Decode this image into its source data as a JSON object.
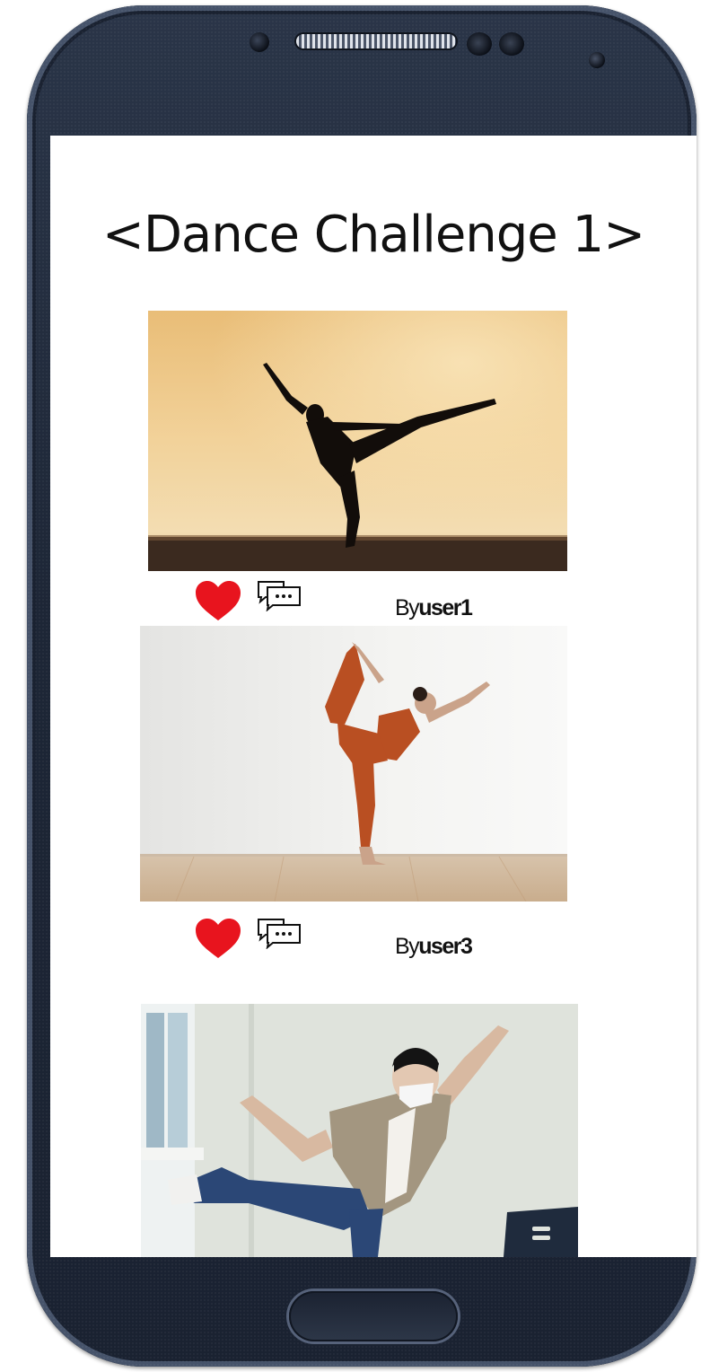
{
  "screen": {
    "title": "<Dance Challenge 1>"
  },
  "posts": [
    {
      "by_prefix": "By",
      "user": "user1",
      "like_icon": "heart-icon",
      "comment_icon": "comment-icon"
    },
    {
      "by_prefix": "By",
      "user": "user3",
      "like_icon": "heart-icon",
      "comment_icon": "comment-icon"
    },
    {
      "by_prefix": "",
      "user": ""
    }
  ],
  "colors": {
    "heart": "#e8141e",
    "phone_body": "#1d2636",
    "screen": "#ffffff"
  }
}
